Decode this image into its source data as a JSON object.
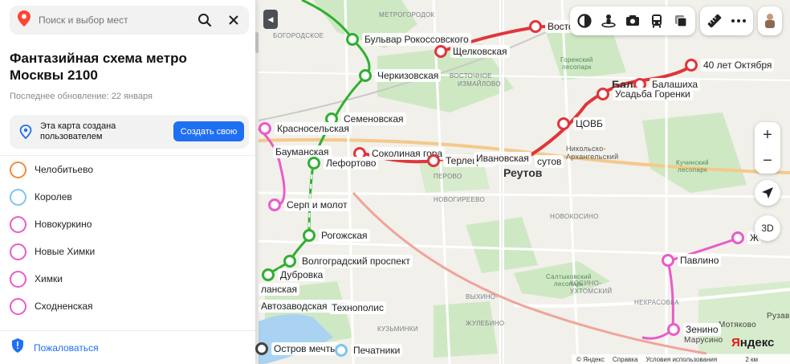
{
  "search": {
    "placeholder": "Поиск и выбор мест"
  },
  "panel": {
    "title": "Фантазийная схема метро Москвы 2100",
    "updated": "Последнее обновление: 22 января",
    "notice_text": "Эта карта создана пользователем",
    "create_button": "Создать свою",
    "complain_label": "Пожаловаться",
    "lines": [
      {
        "name": "Челобитьево",
        "color": "#f08c3a"
      },
      {
        "name": "Королев",
        "color": "#7cc6ef"
      },
      {
        "name": "Новокуркино",
        "color": "#e85cc8"
      },
      {
        "name": "Новые Химки",
        "color": "#e85cc8"
      },
      {
        "name": "Химки",
        "color": "#e85cc8"
      },
      {
        "name": "Сходненская",
        "color": "#e85cc8"
      }
    ]
  },
  "colors": {
    "red_line": "#e0353b",
    "green_line": "#2fb031",
    "pink_line": "#e85cc8",
    "orange_line": "#f08c3a",
    "blue_line": "#7cc6ef",
    "dark_line": "#444444",
    "accent": "#1f6ff2"
  },
  "stations": [
    {
      "name": "Бульвар Рокоссовского",
      "color": "#2fb031"
    },
    {
      "name": "Щелковская",
      "color": "#e0353b"
    },
    {
      "name": "Восто",
      "color": "#e0353b"
    },
    {
      "name": "Черкизовская",
      "color": "#2fb031"
    },
    {
      "name": "40 лет Октября",
      "color": "#e0353b"
    },
    {
      "name": "Балашиха",
      "color": "#e0353b"
    },
    {
      "name": "Усадьба Горенки",
      "color": "#e0353b"
    },
    {
      "name": "Семеновская",
      "color": "#2fb031"
    },
    {
      "name": "Красносельская",
      "color": "#e85cc8"
    },
    {
      "name": "ЦОВБ",
      "color": "#e0353b"
    },
    {
      "name": "Бауманская",
      "color": "#e85cc8"
    },
    {
      "name": "Соколиная гора",
      "color": "#e0353b"
    },
    {
      "name": "Терлецкая",
      "color": "#e0353b"
    },
    {
      "name": "Ивановская",
      "color": "#e0353b"
    },
    {
      "name": "Лефортово",
      "color": "#2fb031"
    },
    {
      "name": "Серп и молот",
      "color": "#e85cc8"
    },
    {
      "name": "Рогожская",
      "color": "#2fb031"
    },
    {
      "name": "Волгоградский проспект",
      "color": "#2fb031"
    },
    {
      "name": "Дубровка",
      "color": "#2fb031"
    },
    {
      "name": "Павлино",
      "color": "#e85cc8"
    },
    {
      "name": "Ж",
      "color": "#e85cc8"
    },
    {
      "name": "Зенино",
      "color": "#e85cc8"
    },
    {
      "name": "Остров мечты",
      "color": "#444444"
    },
    {
      "name": "Печатники",
      "color": "#7cc6ef"
    },
    {
      "name": "Автозаводская (ТЛ)",
      "color": "#444444"
    },
    {
      "name": "Технополис",
      "color": "#444444"
    },
    {
      "name": "ланская",
      "color": "#444444"
    }
  ],
  "map_labels": {
    "reutov": "Реутов",
    "balashikha_part": "Бала",
    "sutov": "сутов",
    "metrogorodok": "МЕТРОГОРОДОК",
    "bogorodskoe": "БОГОРОДСКОЕ",
    "vostochnoe": "ВОСТОЧНОЕ",
    "izmaylovo": "ИЗМАЙЛОВО",
    "perovo": "ПЕРОВО",
    "novogireevo": "НОВОГИРЕЕВО",
    "novokosino": "НОВОКОСИНО",
    "kosino": "КОСИНО-",
    "ukhtomsky": "УХТОМСКИЙ",
    "vykhino": "ВЫХИНО-",
    "zhulebino": "ЖУЛЕБИНО",
    "kuzminki": "КУЗЬМИНКИ",
    "nekrasovka": "НЕКРАСОВКА",
    "marusino": "Марусино",
    "motyakovo": "Мотяково",
    "ruza": "Рузаво",
    "nikolsko": "Никольско-\nАрхангельский",
    "gorenskiy_park": "Горенский\nлесопарк",
    "kuchinskiy_park": "Кучинский\nлесопарк",
    "saltykovskiy_park": "Салтыковский\nлесопарк"
  },
  "controls": {
    "zoom_in": "+",
    "zoom_out": "−",
    "three_d": "3D",
    "logo_prefix": "Я",
    "logo_suffix": "ндекс",
    "scale": "2 км"
  },
  "footer_links": [
    "© Яндекс",
    "Справка",
    "Условия использования"
  ]
}
